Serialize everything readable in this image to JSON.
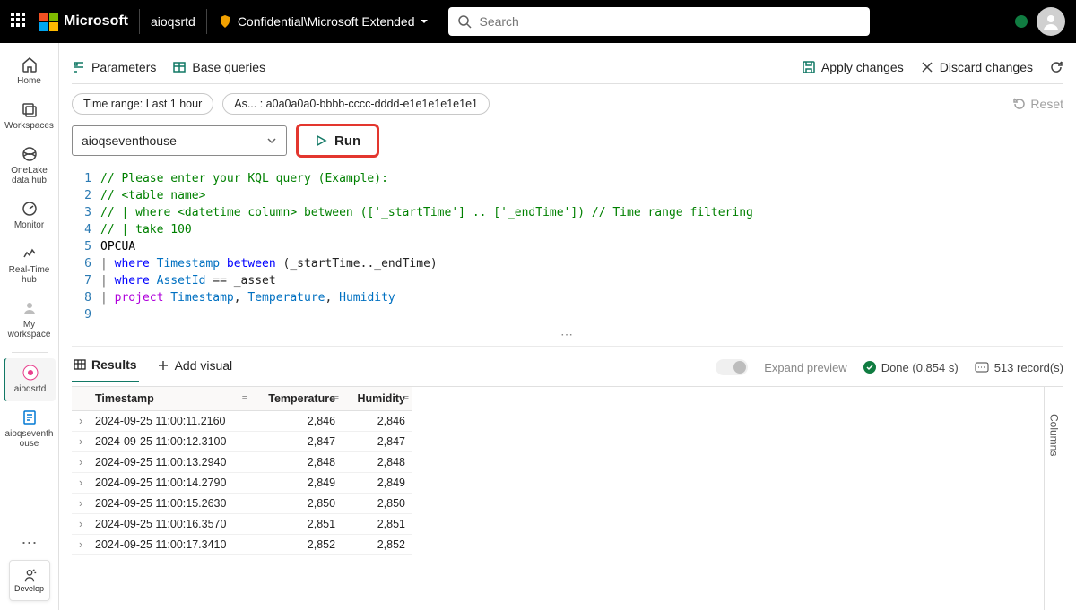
{
  "topbar": {
    "brand": "Microsoft",
    "workspace": "aioqsrtd",
    "sensitivity": "Confidential\\Microsoft Extended",
    "search_placeholder": "Search"
  },
  "rail": {
    "items": [
      {
        "label": "Home"
      },
      {
        "label": "Workspaces"
      },
      {
        "label": "OneLake data hub"
      },
      {
        "label": "Monitor"
      },
      {
        "label": "Real-Time hub"
      },
      {
        "label": "My workspace"
      }
    ],
    "recent": [
      {
        "label": "aioqsrtd"
      },
      {
        "label": "aioqseventh ouse"
      }
    ],
    "develop": "Develop"
  },
  "toolbar": {
    "parameters": "Parameters",
    "base_queries": "Base queries",
    "apply": "Apply changes",
    "discard": "Discard changes"
  },
  "pills": {
    "time_range": "Time range: Last 1 hour",
    "asset": "As... : a0a0a0a0-bbbb-cccc-dddd-e1e1e1e1e1e1",
    "reset": "Reset"
  },
  "run": {
    "scope": "aioqseventhouse",
    "run_label": "Run"
  },
  "editor": {
    "lines": [
      "1",
      "2",
      "3",
      "4",
      "5",
      "6",
      "7",
      "8",
      "9"
    ]
  },
  "results": {
    "tab_results": "Results",
    "add_visual": "Add visual",
    "expand": "Expand preview",
    "done": "Done (0.854 s)",
    "records": "513 record(s)",
    "columns": "Columns"
  },
  "grid": {
    "headers": [
      "Timestamp",
      "Temperature",
      "Humidity"
    ],
    "rows": [
      {
        "ts": "2024-09-25 11:00:11.2160",
        "temp": "2,846",
        "hum": "2,846"
      },
      {
        "ts": "2024-09-25 11:00:12.3100",
        "temp": "2,847",
        "hum": "2,847"
      },
      {
        "ts": "2024-09-25 11:00:13.2940",
        "temp": "2,848",
        "hum": "2,848"
      },
      {
        "ts": "2024-09-25 11:00:14.2790",
        "temp": "2,849",
        "hum": "2,849"
      },
      {
        "ts": "2024-09-25 11:00:15.2630",
        "temp": "2,850",
        "hum": "2,850"
      },
      {
        "ts": "2024-09-25 11:00:16.3570",
        "temp": "2,851",
        "hum": "2,851"
      },
      {
        "ts": "2024-09-25 11:00:17.3410",
        "temp": "2,852",
        "hum": "2,852"
      }
    ]
  }
}
